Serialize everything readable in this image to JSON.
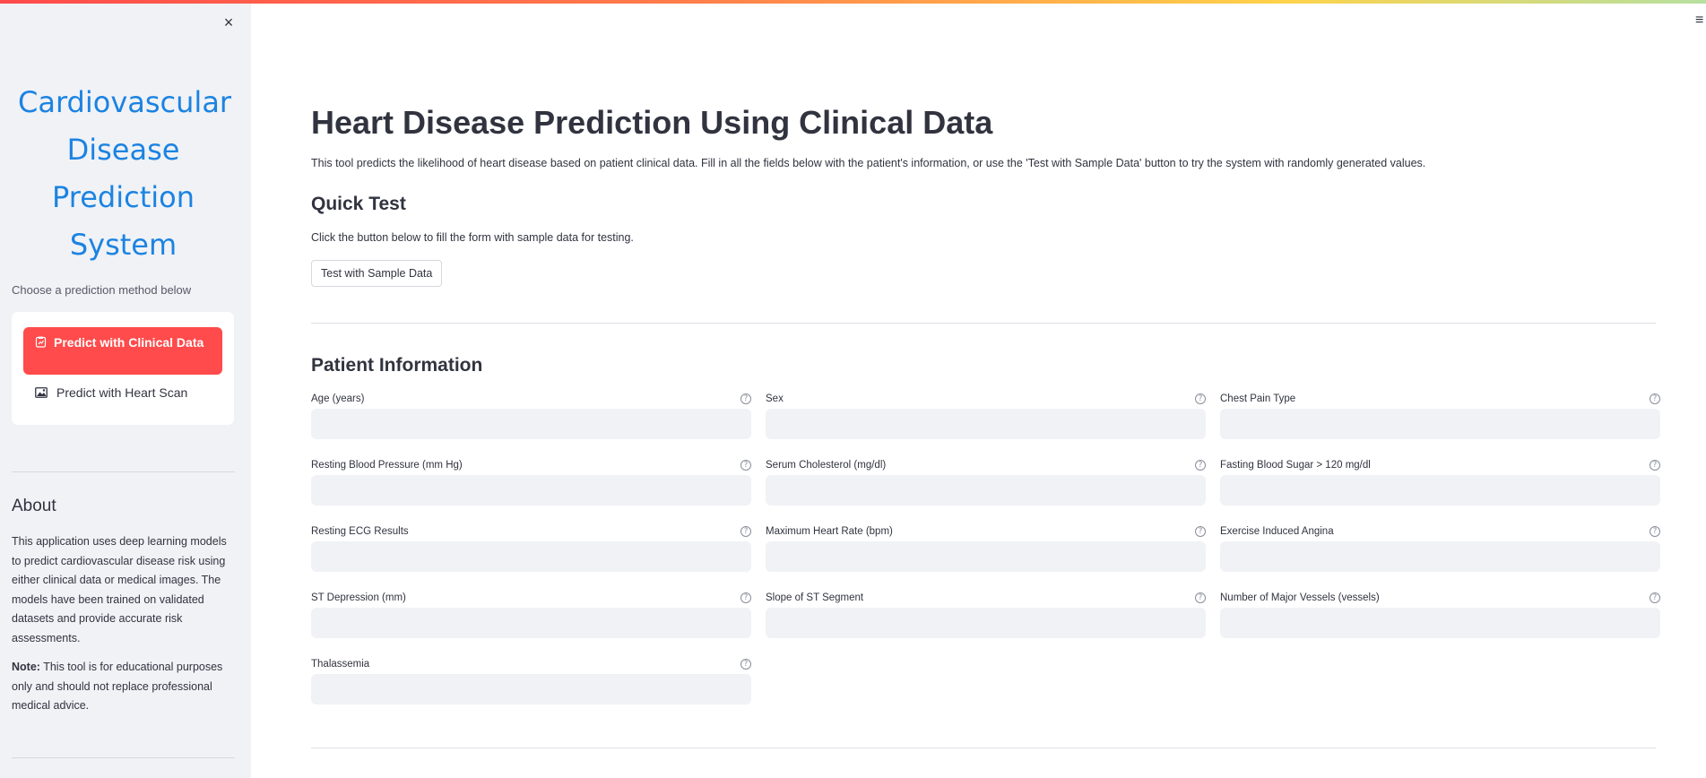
{
  "sidebar": {
    "close_glyph": "×",
    "title": "Cardiovascular Disease Prediction System",
    "choose_text": "Choose a prediction method below",
    "menu": [
      {
        "label": "Predict with Clinical Data",
        "icon": "clipboard-icon",
        "active": true
      },
      {
        "label": "Predict with Heart Scan",
        "icon": "image-icon",
        "active": false
      }
    ],
    "about_title": "About",
    "about_text": "This application uses deep learning models to predict cardiovascular disease risk using either clinical data or medical images. The models have been trained on validated datasets and provide accurate risk assessments.",
    "note_label": "Note:",
    "note_text": " This tool is for educational purposes only and should not replace professional medical advice."
  },
  "header": {
    "menu_glyph": "≡"
  },
  "main": {
    "title": "Heart Disease Prediction Using Clinical Data",
    "intro": "This tool predicts the likelihood of heart disease based on patient clinical data. Fill in all the fields below with the patient's information, or use the 'Test with Sample Data' button to try the system with randomly generated values.",
    "quick_test": {
      "heading": "Quick Test",
      "description": "Click the button below to fill the form with sample data for testing.",
      "button_label": "Test with Sample Data"
    },
    "patient_info": {
      "heading": "Patient Information",
      "help_glyph": "?",
      "fields": [
        {
          "label": "Age (years)",
          "value": ""
        },
        {
          "label": "Sex",
          "value": ""
        },
        {
          "label": "Chest Pain Type",
          "value": ""
        },
        {
          "label": "Resting Blood Pressure (mm Hg)",
          "value": ""
        },
        {
          "label": "Serum Cholesterol (mg/dl)",
          "value": ""
        },
        {
          "label": "Fasting Blood Sugar > 120 mg/dl",
          "value": ""
        },
        {
          "label": "Resting ECG Results",
          "value": ""
        },
        {
          "label": "Maximum Heart Rate (bpm)",
          "value": ""
        },
        {
          "label": "Exercise Induced Angina",
          "value": ""
        },
        {
          "label": "ST Depression (mm)",
          "value": ""
        },
        {
          "label": "Slope of ST Segment",
          "value": ""
        },
        {
          "label": "Number of Major Vessels (vessels)",
          "value": ""
        },
        {
          "label": "Thalassemia",
          "value": ""
        }
      ]
    }
  },
  "colors": {
    "accent": "#ff4b4b",
    "title_blue": "#1c83e1",
    "sidebar_bg": "#f0f2f6",
    "input_bg": "#f0f2f6",
    "text": "#31333f"
  }
}
